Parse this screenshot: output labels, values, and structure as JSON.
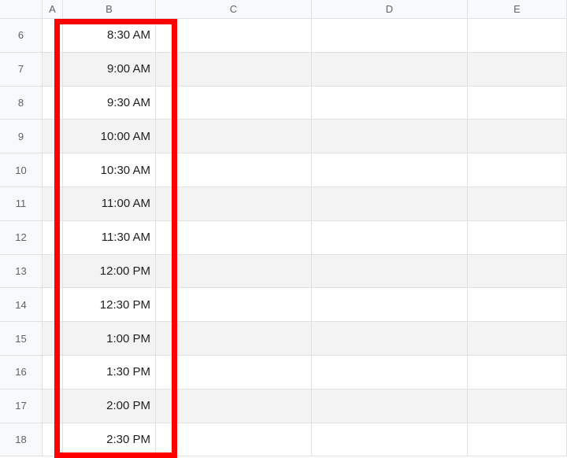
{
  "columns": [
    {
      "label": "A",
      "class": "col-A"
    },
    {
      "label": "B",
      "class": "col-B"
    },
    {
      "label": "C",
      "class": "col-C"
    },
    {
      "label": "D",
      "class": "col-D"
    },
    {
      "label": "E",
      "class": "col-E"
    }
  ],
  "rows": [
    {
      "num": 6,
      "b": "8:30 AM",
      "striped": false
    },
    {
      "num": 7,
      "b": "9:00 AM",
      "striped": true
    },
    {
      "num": 8,
      "b": "9:30 AM",
      "striped": false
    },
    {
      "num": 9,
      "b": "10:00 AM",
      "striped": true
    },
    {
      "num": 10,
      "b": "10:30 AM",
      "striped": false
    },
    {
      "num": 11,
      "b": "11:00 AM",
      "striped": true
    },
    {
      "num": 12,
      "b": "11:30 AM",
      "striped": false
    },
    {
      "num": 13,
      "b": "12:00 PM",
      "striped": true
    },
    {
      "num": 14,
      "b": "12:30 PM",
      "striped": false
    },
    {
      "num": 15,
      "b": "1:00 PM",
      "striped": true
    },
    {
      "num": 16,
      "b": "1:30 PM",
      "striped": false
    },
    {
      "num": 17,
      "b": "2:00 PM",
      "striped": true
    },
    {
      "num": 18,
      "b": "2:30 PM",
      "striped": false
    }
  ]
}
